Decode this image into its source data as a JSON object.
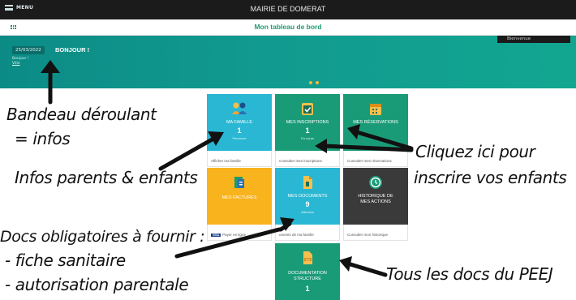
{
  "topbar": {
    "menu_label": "MENU",
    "title": "MAIRIE DE DOMERAT"
  },
  "subbar": {
    "title": "Mon tableau de bord"
  },
  "banner": {
    "date": "25/03/2022",
    "greeting": "BONJOUR !",
    "small_text": "Bonjour !",
    "small_link": "Ville",
    "bienvenue": "Bienvenue"
  },
  "tiles": {
    "famille": {
      "label": "MA FAMILLE",
      "number": "1",
      "sub": "Personne",
      "footer": "Afficher ma famille",
      "color": "#29b7d3"
    },
    "inscriptions": {
      "label": "MES INSCRIPTIONS",
      "number": "1",
      "sub": "En cours",
      "footer": "Consulter mes inscriptions",
      "color": "#1a9b78"
    },
    "reservations": {
      "label": "MES RÉSERVATIONS",
      "footer": "Consulter mes réservations",
      "color": "#1a9b78"
    },
    "factures": {
      "label": "MES FACTURES",
      "footer": "Payer en ligne",
      "visa": "VISA",
      "color": "#f9b31d"
    },
    "documents": {
      "label": "MES DOCUMENTS",
      "number": "9",
      "sub": "Attendus",
      "footer": "uments de ma famille",
      "color": "#29b7d3"
    },
    "historique": {
      "label": "HISTORIQUE DE MES ACTIONS",
      "footer": "Consulter mon historique",
      "color": "#3a3a3a"
    },
    "documentation": {
      "label": "DOCUMENTATION STRUCTURE",
      "number": "1",
      "color": "#1a9b78"
    }
  },
  "annotations": {
    "bandeau1": "Bandeau déroulant",
    "bandeau2": "= infos",
    "infos": "Infos parents & enfants",
    "cliquez1": "Cliquez ici pour",
    "cliquez2": "inscrire vos enfants",
    "docs1": "Docs obligatoires à fournir :",
    "docs2": "- fiche sanitaire",
    "docs3": "- autorisation parentale",
    "peej": "Tous les docs du PEEJ"
  }
}
